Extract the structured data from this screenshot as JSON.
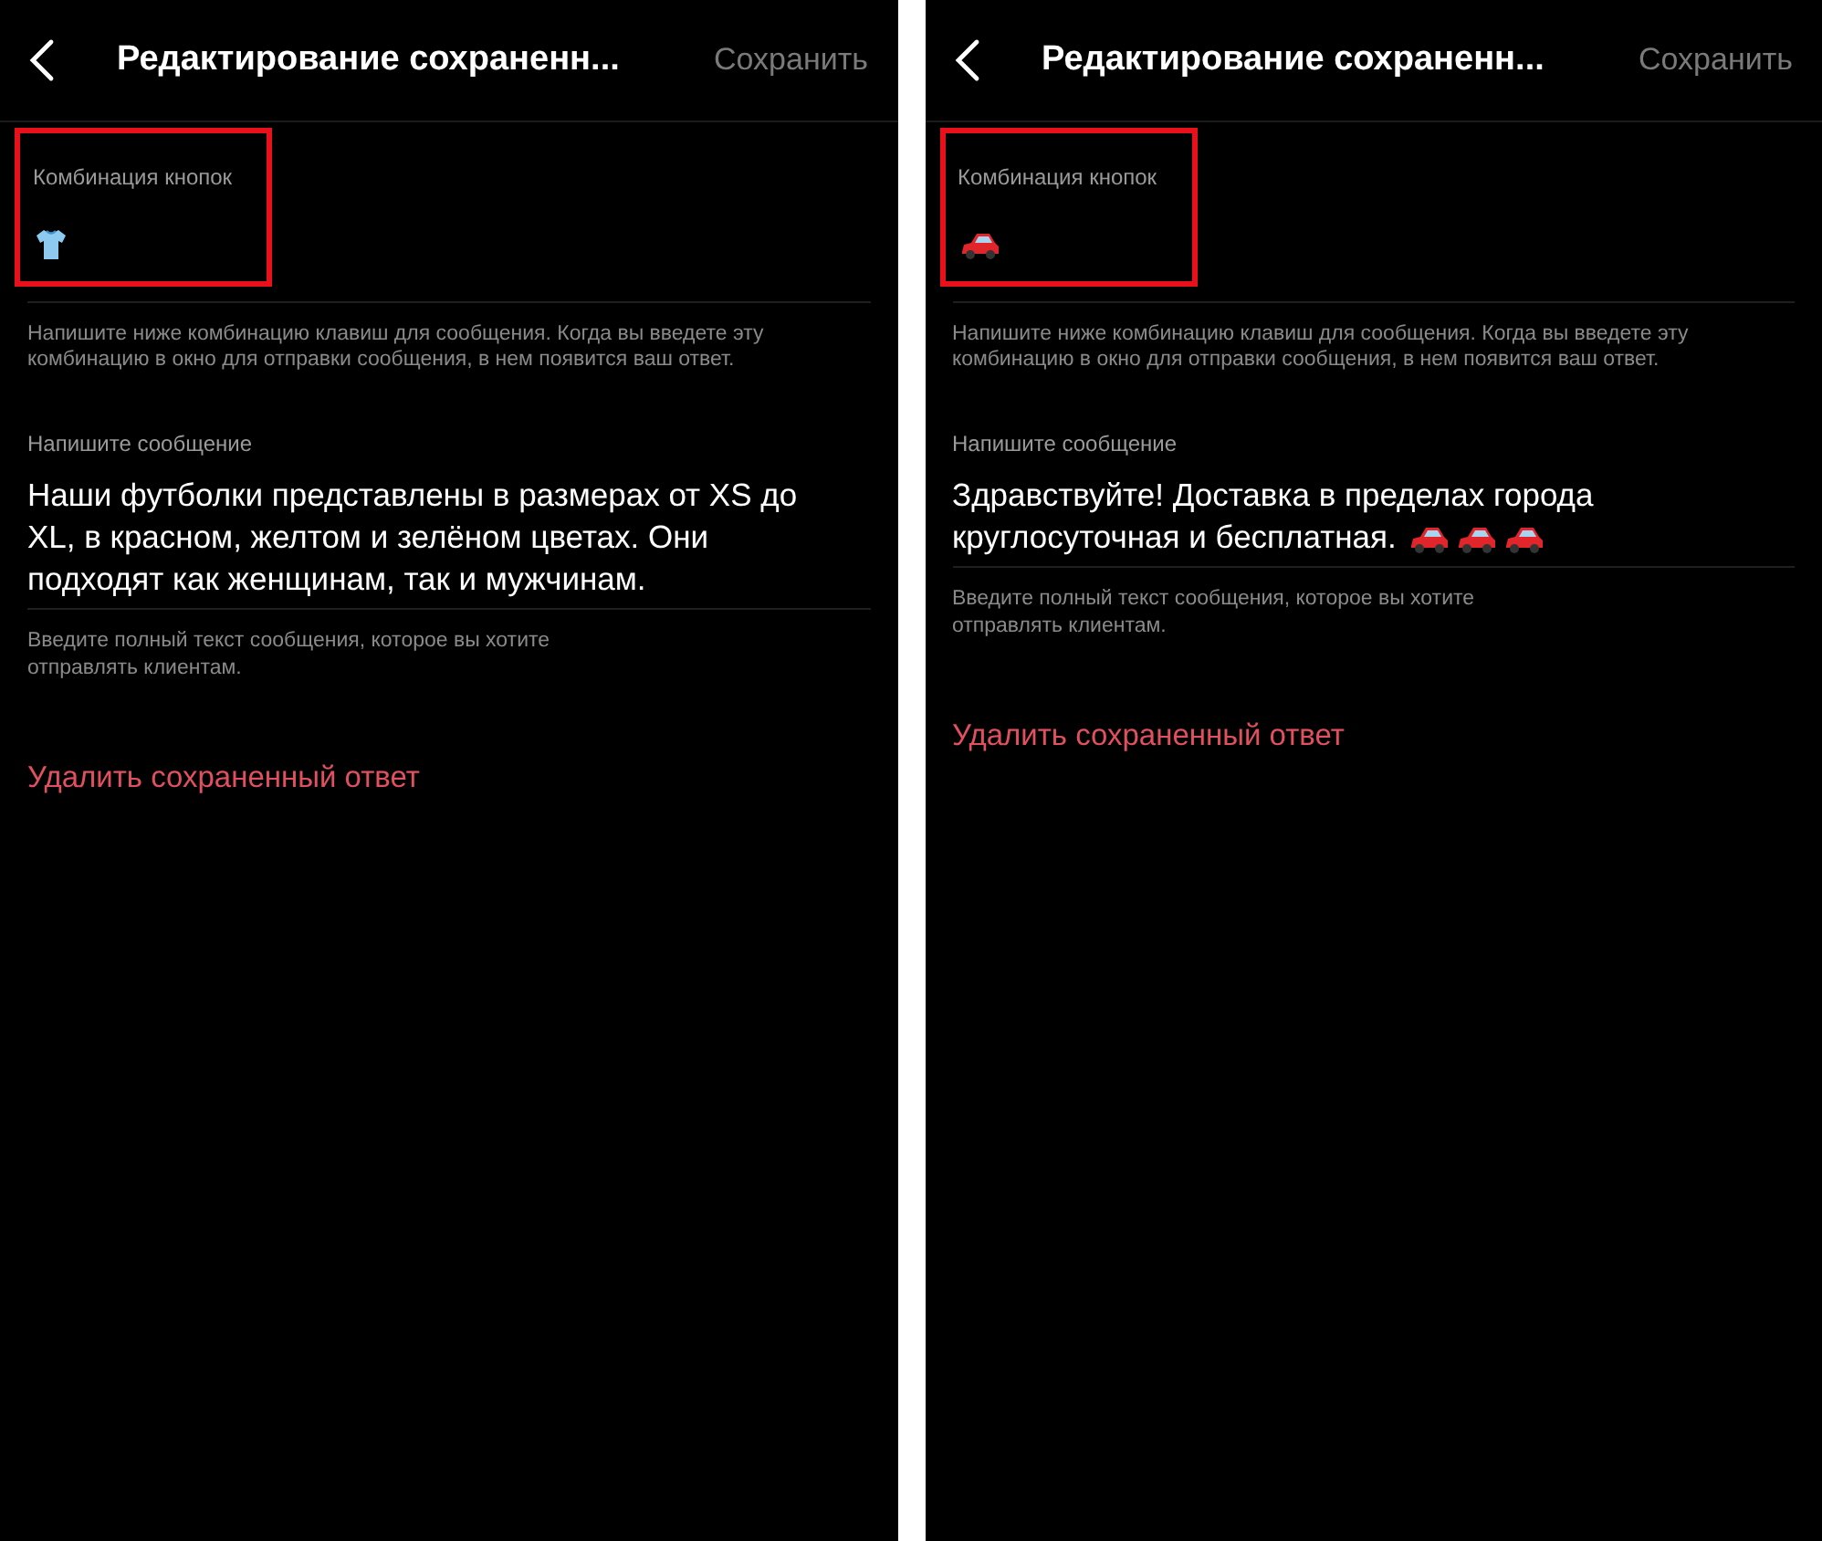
{
  "screens": [
    {
      "header": {
        "title": "Редактирование сохраненн...",
        "save": "Сохранить"
      },
      "shortcut": {
        "label": "Комбинация кнопок",
        "emoji": {
          "kind": "shirt"
        },
        "highlighted": true
      },
      "shortcut_hint": "Напишите ниже комбинацию клавиш для сообщения. Когда вы введете эту комбинацию в окно для отправки сообщения, в нем появится ваш ответ.",
      "message": {
        "label": "Напишите сообщение",
        "text": "Наши футболки представлены в размерах от XS до XL, в красном, желтом и зелёном цветах. Они подходят как женщинам, так и мужчинам."
      },
      "message_hint": "Введите полный текст сообщения, которое вы хотите отправлять клиентам.",
      "delete": "Удалить сохраненный ответ"
    },
    {
      "header": {
        "title": "Редактирование сохраненн...",
        "save": "Сохранить"
      },
      "shortcut": {
        "label": "Комбинация кнопок",
        "emoji": {
          "kind": "car"
        },
        "highlighted": true
      },
      "shortcut_hint": "Напишите ниже комбинацию клавиш для сообщения. Когда вы введете эту комбинацию в окно для отправки сообщения, в нем появится ваш ответ.",
      "message": {
        "label": "Напишите сообщение",
        "text": "Здравствуйте! Доставка в пределах города круглосуточная и бесплатная.",
        "emojis": [
          {
            "kind": "car"
          },
          {
            "kind": "car"
          },
          {
            "kind": "car"
          }
        ]
      },
      "message_hint": "Введите полный текст сообщения, которое вы хотите отправлять клиентам.",
      "delete": "Удалить сохраненный ответ"
    }
  ]
}
